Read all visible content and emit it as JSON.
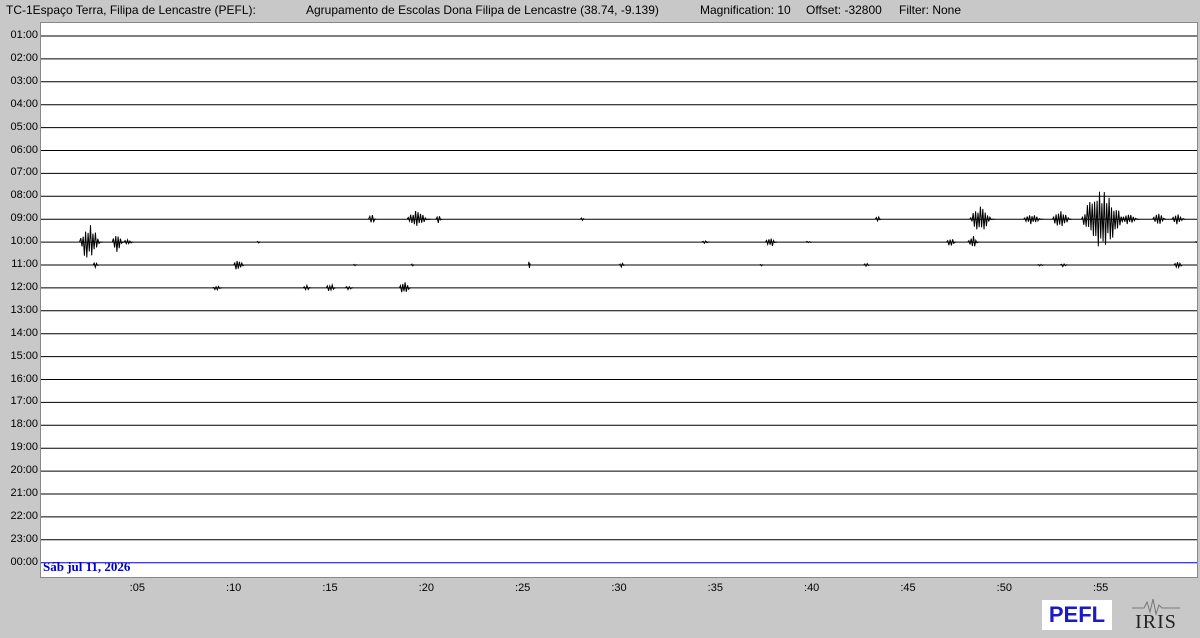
{
  "header": {
    "station": "TC-1Espaço Terra, Filipa de Lencastre (PEFL):",
    "location": "Agrupamento de Escolas Dona Filipa de Lencastre (38.74, -9.139)",
    "magnification": "Magnification: 10",
    "offset": "Offset: -32800",
    "filter": "Filter: None"
  },
  "date_label": "Sáb jul 11, 2026",
  "logos": {
    "pefl": "PEFL",
    "iris": "IRIS"
  },
  "colors": {
    "background": "#c8c8c8",
    "plot_bg": "#ffffff",
    "trace": "#000000",
    "current_line": "#0000cc",
    "date_text": "#0000cc",
    "pefl_text": "#1a1ac8"
  },
  "chart_data": {
    "type": "line",
    "chart_kind": "helicorder",
    "row_labels": [
      "01:00",
      "02:00",
      "03:00",
      "04:00",
      "05:00",
      "06:00",
      "07:00",
      "08:00",
      "09:00",
      "10:00",
      "11:00",
      "12:00",
      "13:00",
      "14:00",
      "15:00",
      "16:00",
      "17:00",
      "18:00",
      "19:00",
      "20:00",
      "21:00",
      "22:00",
      "23:00",
      "00:00"
    ],
    "minute_ticks": [
      ":05",
      ":10",
      ":15",
      ":20",
      ":25",
      ":30",
      ":35",
      ":40",
      ":45",
      ":50",
      ":55"
    ],
    "x_range_minutes": [
      0,
      60
    ],
    "current_row": "00:00",
    "events": [
      {
        "row": "09:00",
        "minute": 17.0,
        "amplitude": 0.5,
        "duration": 0.4
      },
      {
        "row": "09:00",
        "minute": 19.0,
        "amplitude": 0.8,
        "duration": 1.2
      },
      {
        "row": "09:00",
        "minute": 20.5,
        "amplitude": 0.4,
        "duration": 0.3
      },
      {
        "row": "09:00",
        "minute": 28.0,
        "amplitude": 0.2,
        "duration": 0.2
      },
      {
        "row": "09:00",
        "minute": 43.3,
        "amplitude": 0.3,
        "duration": 0.3
      },
      {
        "row": "09:00",
        "minute": 48.2,
        "amplitude": 1.2,
        "duration": 1.3
      },
      {
        "row": "09:00",
        "minute": 51.0,
        "amplitude": 0.5,
        "duration": 1.0
      },
      {
        "row": "09:00",
        "minute": 52.5,
        "amplitude": 0.9,
        "duration": 1.0
      },
      {
        "row": "09:00",
        "minute": 54.0,
        "amplitude": 2.8,
        "duration": 2.5
      },
      {
        "row": "09:00",
        "minute": 56.0,
        "amplitude": 0.5,
        "duration": 1.0
      },
      {
        "row": "09:00",
        "minute": 57.7,
        "amplitude": 0.6,
        "duration": 0.7
      },
      {
        "row": "09:00",
        "minute": 58.7,
        "amplitude": 0.5,
        "duration": 0.7
      },
      {
        "row": "10:00",
        "minute": 2.0,
        "amplitude": 1.8,
        "duration": 1.2
      },
      {
        "row": "10:00",
        "minute": 3.7,
        "amplitude": 0.9,
        "duration": 0.6
      },
      {
        "row": "10:00",
        "minute": 4.3,
        "amplitude": 0.3,
        "duration": 0.5
      },
      {
        "row": "10:00",
        "minute": 11.2,
        "amplitude": 0.1,
        "duration": 0.2
      },
      {
        "row": "10:00",
        "minute": 34.3,
        "amplitude": 0.2,
        "duration": 0.4
      },
      {
        "row": "10:00",
        "minute": 37.6,
        "amplitude": 0.5,
        "duration": 0.6
      },
      {
        "row": "10:00",
        "minute": 39.7,
        "amplitude": 0.1,
        "duration": 0.3
      },
      {
        "row": "10:00",
        "minute": 47.0,
        "amplitude": 0.4,
        "duration": 0.5
      },
      {
        "row": "10:00",
        "minute": 48.1,
        "amplitude": 0.6,
        "duration": 0.6
      },
      {
        "row": "10:00",
        "minute": 59.9,
        "amplitude": 0.1,
        "duration": 0.2
      },
      {
        "row": "11:00",
        "minute": 2.7,
        "amplitude": 0.3,
        "duration": 0.3
      },
      {
        "row": "11:00",
        "minute": 10.0,
        "amplitude": 0.6,
        "duration": 0.6
      },
      {
        "row": "11:00",
        "minute": 16.2,
        "amplitude": 0.1,
        "duration": 0.2
      },
      {
        "row": "11:00",
        "minute": 19.2,
        "amplitude": 0.1,
        "duration": 0.2
      },
      {
        "row": "11:00",
        "minute": 25.3,
        "amplitude": 0.4,
        "duration": 0.1
      },
      {
        "row": "11:00",
        "minute": 30.0,
        "amplitude": 0.2,
        "duration": 0.3
      },
      {
        "row": "11:00",
        "minute": 37.3,
        "amplitude": 0.1,
        "duration": 0.2
      },
      {
        "row": "11:00",
        "minute": 42.7,
        "amplitude": 0.2,
        "duration": 0.3
      },
      {
        "row": "11:00",
        "minute": 51.7,
        "amplitude": 0.1,
        "duration": 0.4
      },
      {
        "row": "11:00",
        "minute": 52.9,
        "amplitude": 0.2,
        "duration": 0.4
      },
      {
        "row": "11:00",
        "minute": 58.8,
        "amplitude": 0.3,
        "duration": 0.5
      },
      {
        "row": "12:00",
        "minute": 8.9,
        "amplitude": 0.2,
        "duration": 0.5
      },
      {
        "row": "12:00",
        "minute": 13.6,
        "amplitude": 0.3,
        "duration": 0.4
      },
      {
        "row": "12:00",
        "minute": 14.8,
        "amplitude": 0.4,
        "duration": 0.5
      },
      {
        "row": "12:00",
        "minute": 15.8,
        "amplitude": 0.2,
        "duration": 0.4
      },
      {
        "row": "12:00",
        "minute": 18.6,
        "amplitude": 0.7,
        "duration": 0.6
      }
    ]
  }
}
